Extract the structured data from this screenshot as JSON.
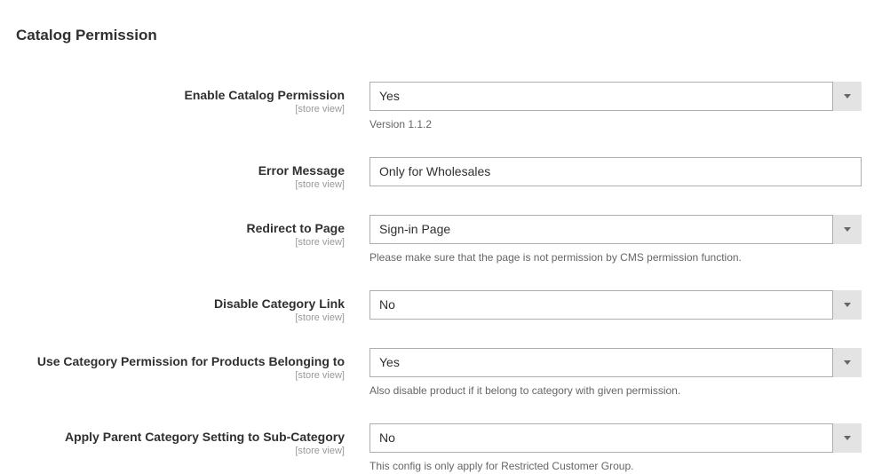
{
  "section": {
    "title": "Catalog Permission"
  },
  "fields": {
    "enable": {
      "label": "Enable Catalog Permission",
      "scope": "[store view]",
      "value": "Yes",
      "note": "Version 1.1.2"
    },
    "error_message": {
      "label": "Error Message",
      "scope": "[store view]",
      "value": "Only for Wholesales"
    },
    "redirect": {
      "label": "Redirect to Page",
      "scope": "[store view]",
      "value": "Sign-in Page",
      "note": "Please make sure that the page is not permission by CMS permission function."
    },
    "disable_category_link": {
      "label": "Disable Category Link",
      "scope": "[store view]",
      "value": "No"
    },
    "use_category_permission": {
      "label": "Use Category Permission for Products Belonging to",
      "scope": "[store view]",
      "value": "Yes",
      "note": "Also disable product if it belong to category with given permission."
    },
    "apply_parent": {
      "label": "Apply Parent Category Setting to Sub-Category",
      "scope": "[store view]",
      "value": "No",
      "note": "This config is only apply for Restricted Customer Group."
    }
  }
}
